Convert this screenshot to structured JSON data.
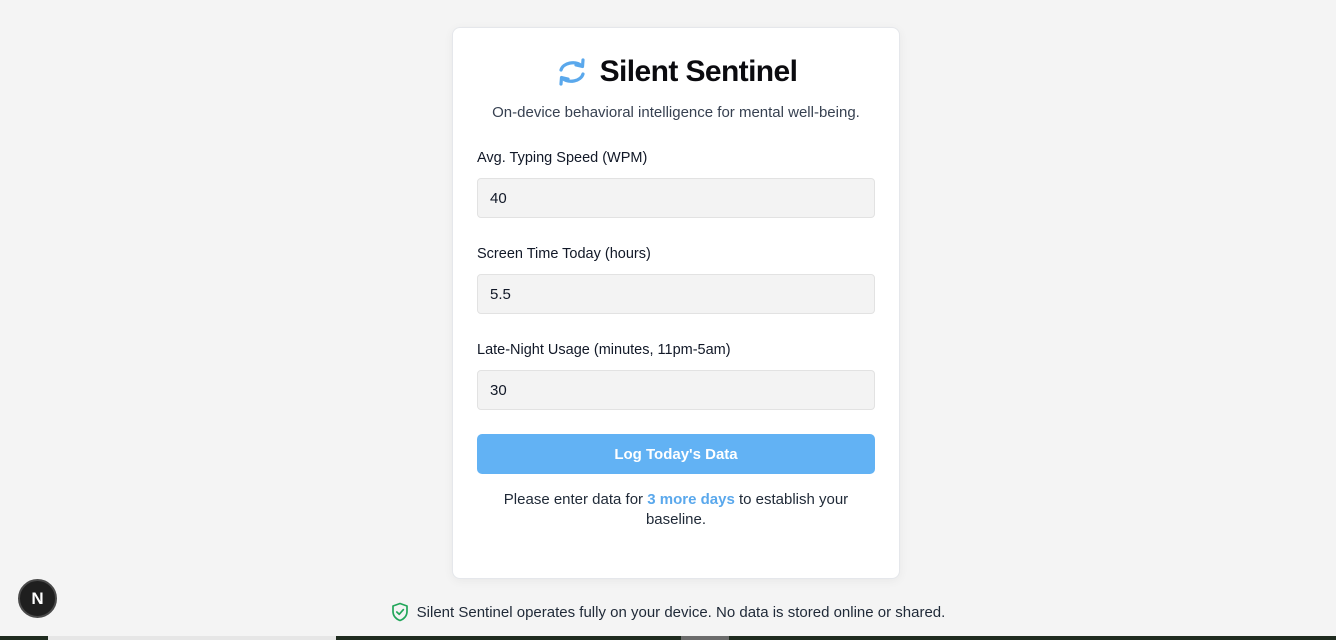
{
  "app": {
    "title": "Silent Sentinel",
    "subtitle": "On-device behavioral intelligence for mental well-being.",
    "logo_icon": "refresh-cycle-icon",
    "accent_color": "#62b2f4"
  },
  "form": {
    "typing_speed": {
      "label": "Avg. Typing Speed (WPM)",
      "value": "40"
    },
    "screen_time": {
      "label": "Screen Time Today (hours)",
      "value": "5.5"
    },
    "late_night": {
      "label": "Late-Night Usage (minutes, 11pm-5am)",
      "value": "30"
    },
    "submit_label": "Log Today's Data"
  },
  "hint": {
    "prefix": "Please enter data for ",
    "highlight": "3 more days",
    "suffix": " to establish your baseline."
  },
  "footer": {
    "icon": "shield-check-icon",
    "text": "Silent Sentinel operates fully on your device. No data is stored online or shared."
  },
  "dev_badge": {
    "label": "N"
  }
}
